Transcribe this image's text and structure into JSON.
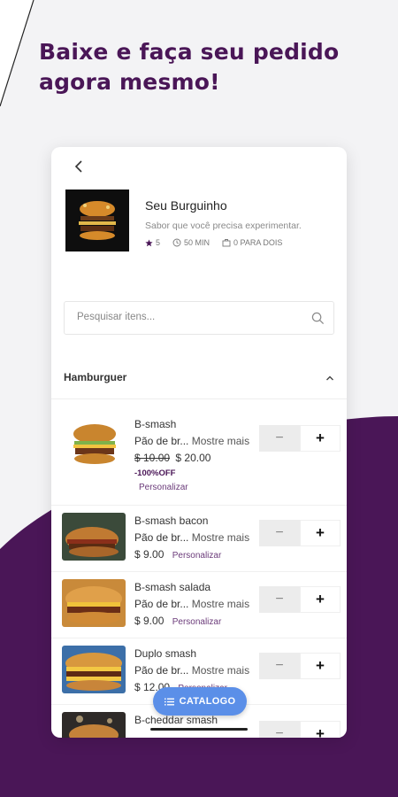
{
  "headline": "Baixe e faça seu pedido agora mesmo!",
  "colors": {
    "brand_purple": "#4a1657",
    "accent_blue": "#5b8fe8"
  },
  "store": {
    "name": "Seu Burguinho",
    "description": "Sabor que você precisa experimentar.",
    "rating": "5",
    "time": "50 MIN",
    "people": "0 PARA DOIS"
  },
  "search": {
    "placeholder": "Pesquisar itens..."
  },
  "category": {
    "title": "Hamburguer"
  },
  "items": [
    {
      "name": "B-smash",
      "desc": "Pão de br...",
      "more": "Mostre mais",
      "old_price": "$ 10.00",
      "price": "$ 20.00",
      "discount": "-100%OFF",
      "customize": "Personalizar"
    },
    {
      "name": "B-smash bacon",
      "desc": "Pão de br...",
      "more": "Mostre mais",
      "price": "$ 9.00",
      "customize": "Personalizar"
    },
    {
      "name": "B-smash salada",
      "desc": "Pão de br...",
      "more": "Mostre mais",
      "price": "$ 9.00",
      "customize": "Personalizar"
    },
    {
      "name": "Duplo smash",
      "desc": "Pão de br...",
      "more": "Mostre mais",
      "price": "$ 12.00",
      "customize": "Personalizar"
    },
    {
      "name": "B-cheddar smash"
    }
  ],
  "stepper": {
    "minus": "−",
    "plus": "+"
  },
  "catalog_button": "CATALOGO",
  "icons": [
    "back-arrow-icon",
    "star-icon",
    "clock-icon",
    "bag-icon",
    "search-icon",
    "chevron-up-icon",
    "list-icon"
  ]
}
